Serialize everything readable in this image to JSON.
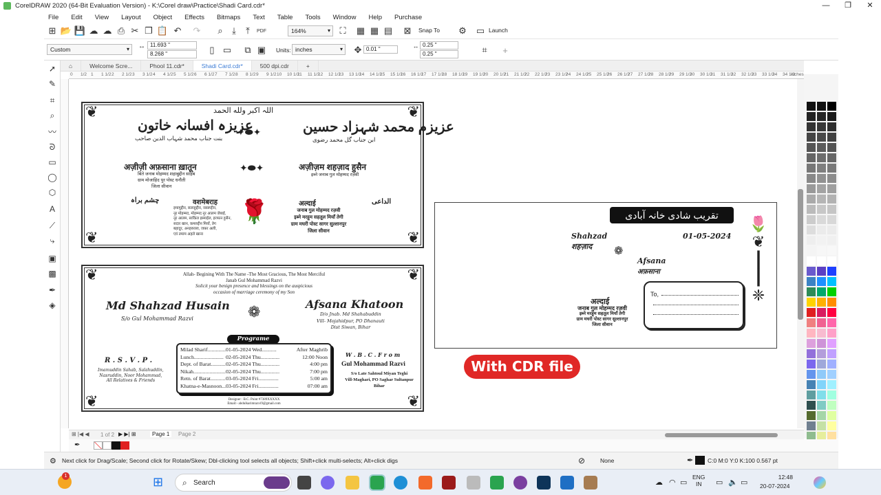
{
  "window": {
    "title": "CorelDRAW 2020 (64-Bit Evaluation Version) - K:\\Corel draw\\Practice\\Shadi Card.cdr*",
    "controls": [
      "—",
      "❐",
      "✕"
    ]
  },
  "menu": [
    "File",
    "Edit",
    "View",
    "Layout",
    "Object",
    "Effects",
    "Bitmaps",
    "Text",
    "Table",
    "Tools",
    "Window",
    "Help",
    "Purchase"
  ],
  "toolbar1": {
    "zoom": "164%",
    "snap": "Snap To",
    "launch": "Launch",
    "pdf": "PDF"
  },
  "toolbar2": {
    "preset": "Custom",
    "width": "11.693 \"",
    "height": "8.268 \"",
    "units_label": "Units:",
    "units": "inches",
    "nudge": "0.01 \"",
    "dup_x": "0.25 \"",
    "dup_y": "0.25 \""
  },
  "tabs": [
    {
      "label": "Welcome Scre..."
    },
    {
      "label": "Phool 11.cdr*"
    },
    {
      "label": "Shadi Card.cdr*"
    },
    {
      "label": "500 dpi.cdr"
    }
  ],
  "ruler": {
    "unit": "inches",
    "ticks": [
      "0",
      "1/2",
      "1",
      "1 1/2",
      "2",
      "2 1/2",
      "3",
      "3 1/2",
      "4",
      "4 1/2",
      "5",
      "5 1/2",
      "6",
      "6 1/2",
      "7",
      "7 1/2",
      "8",
      "8 1/2",
      "9",
      "9 1/2",
      "10",
      "10 1/2",
      "11",
      "11 1/2",
      "12",
      "12 1/2",
      "13",
      "13 1/2",
      "14",
      "14 1/2",
      "15",
      "15 1/2",
      "16",
      "16 1/2",
      "17",
      "17 1/2",
      "18",
      "18 1/2",
      "19",
      "19 1/2",
      "20",
      "20 1/2",
      "21",
      "21 1/2",
      "22",
      "22 1/2",
      "23",
      "23 1/2",
      "24",
      "24 1/2",
      "25",
      "25 1/2",
      "26",
      "26 1/2",
      "27",
      "27 1/2",
      "28",
      "28 1/2",
      "29",
      "29 1/2",
      "30",
      "30 1/2",
      "31",
      "31 1/2",
      "32",
      "32 1/2",
      "33",
      "33 1/2",
      "34",
      "34 1/2"
    ]
  },
  "card_top": {
    "bismillah": "اللہ اکبر ولله الحمد",
    "bride_urdu": "عزیزہ افسانہ خاتون",
    "bride_urdu_sub": "بنت جناب محمد شہاب الدین صاحب",
    "groom_urdu": "عزیزم محمد شہزاد حسین",
    "groom_urdu_sub": "ابن جناب گل محمد رضوی",
    "bride_hindi": "अज़ीज़ी अफ़साना ख़ातून",
    "bride_hindi_sub1": "बिंते जनाब मोहम्मद शहाबुद्दीन साहब",
    "bride_hindi_sub2": "ग्राम मोजाहिद पुर पोस्ट धनौती",
    "bride_hindi_sub3": "जिला सीवान",
    "groom_hindi": "अज़ीज़म शहज़ाद हुसैन",
    "groom_hindi_sub": "इब्ने जनाब गुल मोहम्मद रज़वी",
    "left_heading": "वशमेबराह",
    "left_urdu_heading": "چشم براہ",
    "left_names": [
      "इमामुद्दीन, सलाहुद्दीन, नसरूद्दीन,",
      "नूर मोहम्मद, मोहम्मद नूर आलम जेबाई,",
      "नूर आलम, साकिल इस्माईल, इरफान हुसैन,",
      "सदार खान, कमरुद्दीन मियाँ, तेग",
      "बहादुर, अनहरुल्ला, जफ़र अली,",
      "एवं तमाम अहले खाना"
    ],
    "right_heading": "अल्दाई",
    "right_urdu_heading": "الداعی",
    "right_lines": [
      "जनाब गुल मोहम्मद रज़वी",
      "इब्ने मरहूम सहतूल मियाँ तेगी",
      "ग्राम मघरी पोस्ट सागर सुल्तानपुर",
      "जिला सीवान"
    ]
  },
  "card_bottom": {
    "line1": "Allah- Begining With The Name -The Most Gracious, The Most Merciful",
    "line2": "Janab Gul Mohammad Razvi",
    "line3": "Solicit your benign presence and blessings on the auspicious",
    "line4": "occasion of marriage ceremony of my Son",
    "groom": "Md Shahzad Husain",
    "groom_sub": "S/o Gul Mohammad Razvi",
    "bride": "Afsana Khatoon",
    "bride_sub1": "D/o Jnab. Md Shahabuddin",
    "bride_sub2": "Vill- Mojahidpur, PO Dhanauti",
    "bride_sub3": "Dist Siwan, Bihar",
    "rsvp": "R . S . V . P .",
    "rsvp_names": [
      "Imamuddin Sahab, Salahuddin,",
      "Nasruddin, Noor Mohammad,",
      "All Relatives & Friends"
    ],
    "programme_title": "Programe",
    "programme": [
      {
        "event": "Milad Sharif..............",
        "date": "01-05-2024 Wed...........",
        "time": "After Maghrib"
      },
      {
        "event": "Lunch......................",
        "date": "02-05-2024 Thu..............",
        "time": "12:00 Noon"
      },
      {
        "event": "Dept. of Barat.............",
        "date": "02-05-2024 Thu..............",
        "time": "4:00 pm"
      },
      {
        "event": "Nikah........................",
        "date": "02-05-2024 Thu..............",
        "time": "7:00 pm"
      },
      {
        "event": "Retn. of Barat..............",
        "date": "03-05-2024 Fri...............",
        "time": "5:00 am"
      },
      {
        "event": "Khatna-e-Masnoon........",
        "date": "03-05-2024 Fri...............",
        "time": "07:00 am"
      }
    ],
    "from_title": "W . B . C . F r o m",
    "from_name": "Gul Mohammad Razvi",
    "from_line1": "S/o Late Sahtoul Miyan Teghi",
    "from_line2": "Vill-Maghari, PO Saghar Sultanpur",
    "from_line3": "Bihar",
    "designer": "Designer : B.C. Point #7389XXXXX",
    "email": "Email:- abdulkarimrazvi9@gmail.com"
  },
  "envelope": {
    "header_urdu": "تقریب شادی خانہ آبادی",
    "shahzad_en": "Shahzad",
    "shahzad_hi": "शहज़ाद",
    "date": "01-05-2024",
    "afsana_en": "Afsana",
    "afsana_hi": "अफ़साना",
    "aldai": "अल्दाई",
    "lines": [
      "जनाब गुल मोहम्मद रज़वी",
      "इब्ने मरहूम सहतूल मियाँ तेगी",
      "ग्राम मघरी पोस्ट सागर सुल्तानपुर",
      "जिला सीवान"
    ],
    "to_label": "To,"
  },
  "badge": "With CDR file",
  "pagebar": {
    "counter": "1 of 2",
    "page1": "Page 1",
    "page2": "Page 2"
  },
  "status": {
    "hint": "Next click for Drag/Scale; Second click for Rotate/Skew; Dbl-clicking tool selects all objects; Shift+click multi-selects; Alt+click digs",
    "fill": "None",
    "outline": "C:0 M:0 Y:0 K:100  0.567 pt"
  },
  "taskbar": {
    "search": "Search",
    "lang1": "ENG",
    "lang2": "IN",
    "time": "12:48",
    "date": "20-07-2024",
    "badge": "1"
  },
  "colors": {
    "accent": "#3a7bd5",
    "badge_red": "#e02826"
  }
}
